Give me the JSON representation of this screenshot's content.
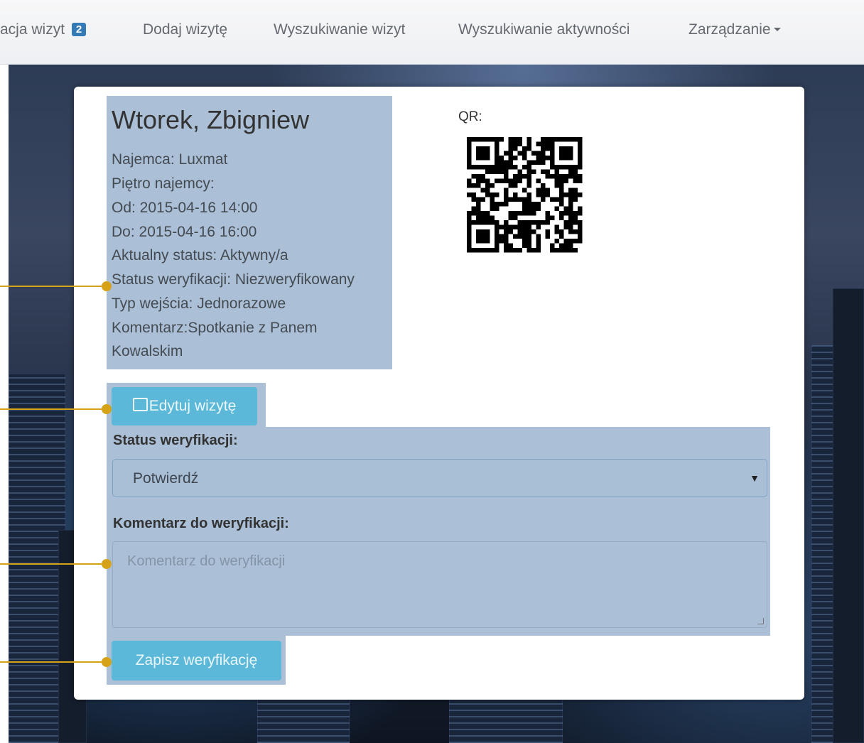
{
  "navbar": {
    "items": [
      {
        "label": "acja wizyt",
        "badge": "2"
      },
      {
        "label": "Dodaj wizytę"
      },
      {
        "label": "Wyszukiwanie wizyt"
      },
      {
        "label": "Wyszukiwanie aktywności"
      },
      {
        "label": "Zarządzanie"
      }
    ]
  },
  "visit": {
    "name": "Wtorek, Zbigniew",
    "lines": [
      "Najemca: Luxmat",
      "Piętro najemcy:",
      "Od: 2015-04-16 14:00",
      "Do: 2015-04-16 16:00",
      "Aktualny status: Aktywny/a",
      "Status weryfikacji: Niezweryfikowany",
      "Typ wejścia: Jednorazowe",
      "Komentarz:Spotkanie z Panem",
      "Kowalskim"
    ]
  },
  "qr": {
    "label": "QR:"
  },
  "actions": {
    "edit_label": "Edytuj wizytę",
    "edit_icon": "edit-icon",
    "save_label": "Zapisz weryfikację"
  },
  "verification": {
    "status_label": "Status weryfikacji:",
    "status_value": "Potwierdź",
    "comment_label": "Komentarz do weryfikacji:",
    "comment_placeholder": "Komentarz do weryfikacji",
    "comment_value": ""
  },
  "colors": {
    "highlight": "#abc0d6",
    "button": "#5bb8d8",
    "callout": "#d6a218",
    "badge": "#337ab7"
  }
}
